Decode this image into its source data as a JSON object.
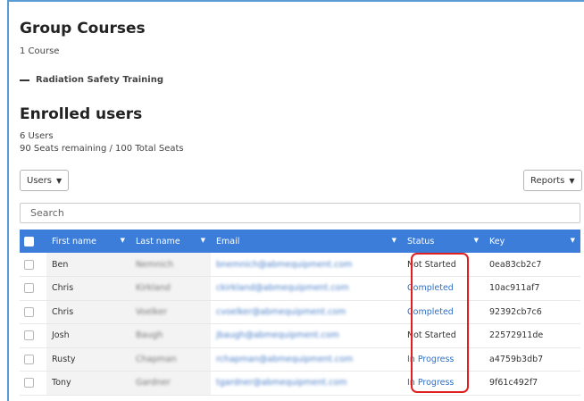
{
  "group": {
    "title": "Group Courses",
    "course_count": "1 Course",
    "course_name": "Radiation Safety Training"
  },
  "enrolled": {
    "title": "Enrolled users",
    "user_count": "6 Users",
    "seats": "90 Seats remaining / 100 Total Seats"
  },
  "toolbar": {
    "users_label": "Users",
    "reports_label": "Reports"
  },
  "search": {
    "placeholder": "Search"
  },
  "table": {
    "headers": {
      "first": "First name",
      "last": "Last name",
      "email": "Email",
      "status": "Status",
      "key": "Key"
    },
    "rows": [
      {
        "first": "Ben",
        "last": "Nemnich",
        "email": "bnemnich@abmequipment.com",
        "status": "Not Started",
        "key": "0ea83cb2c7"
      },
      {
        "first": "Chris",
        "last": "Kirkland",
        "email": "ckirkland@abmequipment.com",
        "status": "Completed",
        "key": "10ac911af7"
      },
      {
        "first": "Chris",
        "last": "Voelker",
        "email": "cvoelker@abmequipment.com",
        "status": "Completed",
        "key": "92392cb7c6"
      },
      {
        "first": "Josh",
        "last": "Baugh",
        "email": "jbaugh@abmequipment.com",
        "status": "Not Started",
        "key": "22572911de"
      },
      {
        "first": "Rusty",
        "last": "Chapman",
        "email": "rchapman@abmequipment.com",
        "status": "In Progress",
        "key": "a4759b3db7"
      },
      {
        "first": "Tony",
        "last": "Gardner",
        "email": "tgardner@abmequipment.com",
        "status": "In Progress",
        "key": "9f61c492f7"
      }
    ]
  },
  "colors": {
    "header_bg": "#3b7dd8",
    "link_blue": "#2e6fc7",
    "highlight_red": "#e02020"
  }
}
